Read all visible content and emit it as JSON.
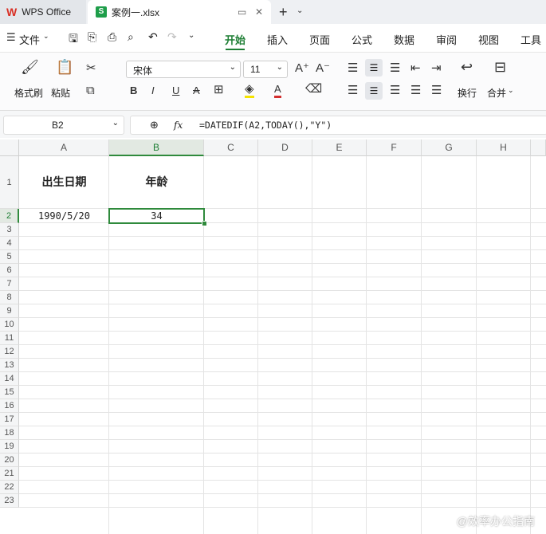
{
  "tabs": {
    "wps_label": "WPS Office",
    "file_label": "案例一.xlsx"
  },
  "menu": {
    "file_label": "文件",
    "items": [
      "开始",
      "插入",
      "页面",
      "公式",
      "数据",
      "审阅",
      "视图",
      "工具"
    ]
  },
  "ribbon": {
    "format_painter": "格式刷",
    "paste": "粘贴",
    "font_name": "宋体",
    "font_size": "11",
    "wrap": "换行",
    "merge": "合并"
  },
  "formula_bar": {
    "cell_ref": "B2",
    "fx": "fx",
    "formula": "=DATEDIF(A2,TODAY(),\"Y\")"
  },
  "sheet": {
    "columns": [
      "A",
      "B",
      "C",
      "D",
      "E",
      "F",
      "G",
      "H"
    ],
    "rows": [
      "1",
      "2",
      "3",
      "4",
      "5",
      "6",
      "7",
      "8",
      "9",
      "10",
      "11",
      "12",
      "13",
      "14",
      "15",
      "16",
      "17",
      "18",
      "19",
      "20",
      "21",
      "22",
      "23"
    ],
    "a1": "出生日期",
    "b1": "年龄",
    "a2": "1990/5/20",
    "b2": "34"
  },
  "watermark": "@效率办公指南",
  "colors": {
    "accent": "#1e7e34",
    "selection": "#2f8a3c"
  }
}
